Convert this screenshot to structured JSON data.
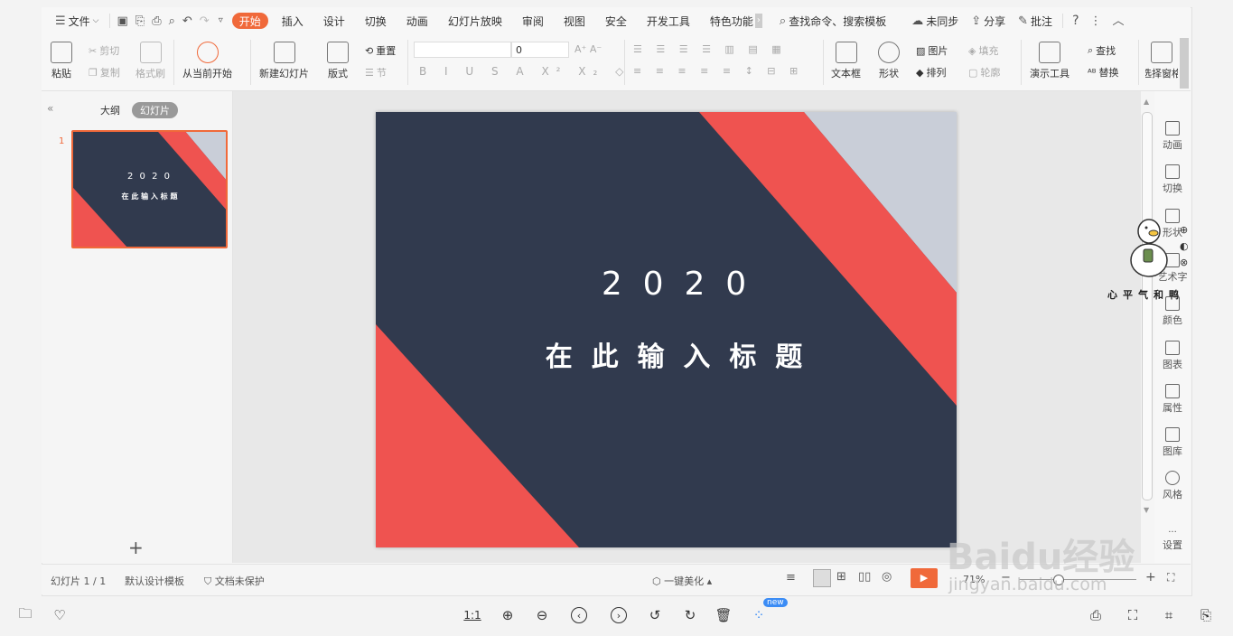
{
  "menu": {
    "file_label": "文件",
    "tabs": [
      "开始",
      "插入",
      "设计",
      "切换",
      "动画",
      "幻灯片放映",
      "审阅",
      "视图",
      "安全",
      "开发工具",
      "特色功能"
    ],
    "active_tab": "开始",
    "search_label": "查找命令、搜索模板",
    "sync_label": "未同步",
    "share_label": "分享",
    "comment_label": "批注"
  },
  "ribbon": {
    "paste": "粘贴",
    "cut": "剪切",
    "copy": "复制",
    "format_painter": "格式刷",
    "play_from_current": "从当前开始",
    "new_slide": "新建幻灯片",
    "layout": "版式",
    "reset": "重置",
    "section": "节",
    "font_size_value": "0",
    "text_box": "文本框",
    "shape": "形状",
    "picture": "图片",
    "fill": "填充",
    "arrange": "排列",
    "outline": "轮廓",
    "presenter_tools": "演示工具",
    "find": "查找",
    "replace": "替换",
    "select_pane": "选择窗格"
  },
  "left_panel": {
    "tab_outline": "大纲",
    "tab_slides": "幻灯片",
    "slide_number": "1",
    "thumb_year": "2 0 2 0",
    "thumb_title": "在 此 输 入 标 题",
    "add_icon": "+"
  },
  "slide": {
    "year": "2  0  2  0",
    "title": "在  此  输  入  标  题",
    "colors": {
      "bg": "#313a4e",
      "red": "#ef5350",
      "grey": "#c9ced8"
    }
  },
  "right_rail": {
    "items": [
      "动画",
      "切换",
      "形状",
      "艺术字",
      "颜色",
      "图表",
      "属性",
      "图库",
      "风格",
      "设置"
    ]
  },
  "watermark": {
    "sticker_text": "心平气和鸭",
    "brand": "Baidu经验",
    "url": "jingyan.baidu.com"
  },
  "status": {
    "slide_count": "幻灯片 1 / 1",
    "template": "默认设计模板",
    "protection": "文档未保护",
    "beautify": "一键美化",
    "zoom": "71%"
  },
  "viewer": {
    "ratio_label": "1:1",
    "new_badge": "new"
  }
}
